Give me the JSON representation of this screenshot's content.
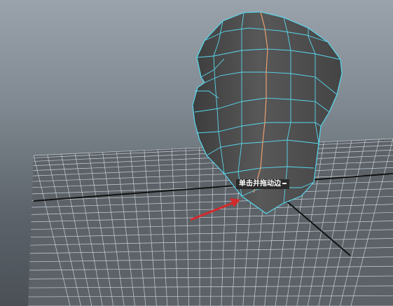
{
  "viewport": {
    "tooltip": "单击并拖动边",
    "colors": {
      "grid_line": "#c8d0d6",
      "grid_axis": "#111111",
      "mesh_wire": "#58d8ee",
      "mesh_fill": "#4a4a4a",
      "selected_edge": "#e8a070",
      "arrow": "#d42a2a"
    },
    "mesh_name": "head-mesh-wireframe",
    "pointer": "red-arrow-icon"
  }
}
